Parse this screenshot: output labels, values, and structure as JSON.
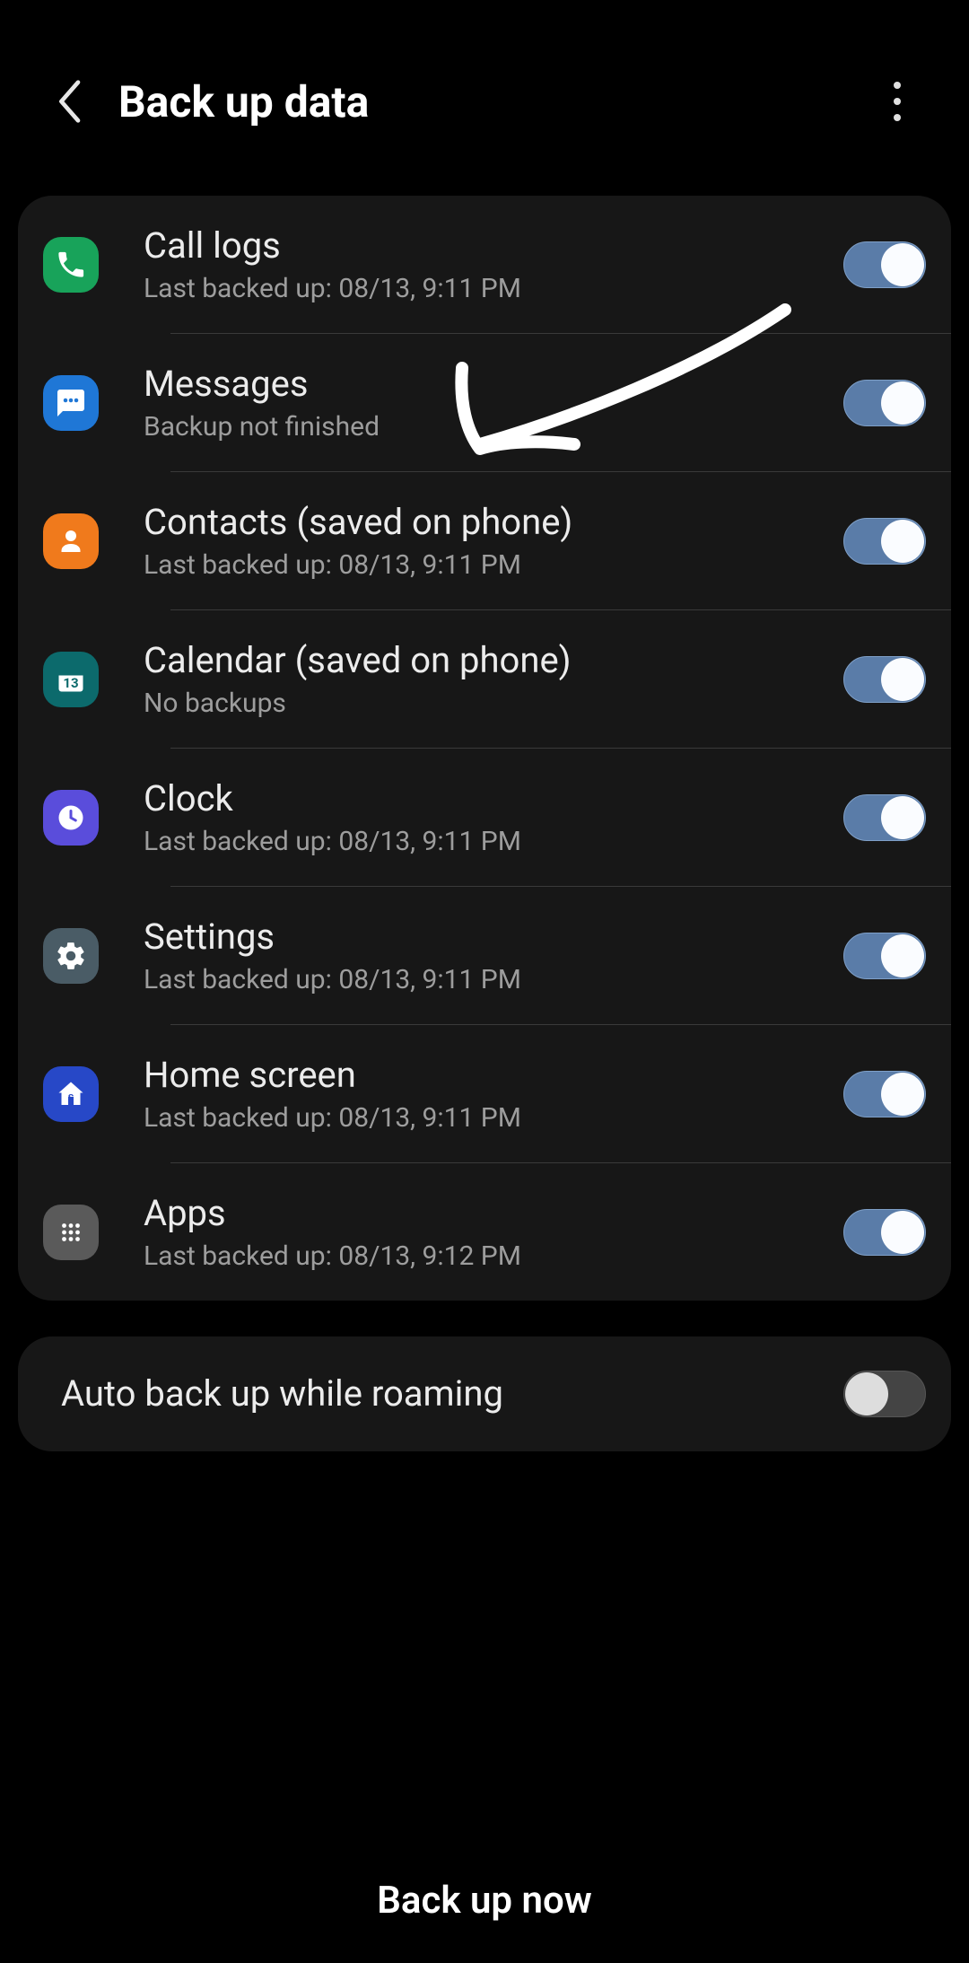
{
  "header": {
    "title": "Back up data"
  },
  "items": [
    {
      "id": "call-logs",
      "title": "Call logs",
      "sub": "Last backed up: 08/13, 9:11 PM",
      "on": true,
      "icon": "phone",
      "bg": "ic-call"
    },
    {
      "id": "messages",
      "title": "Messages",
      "sub": "Backup not finished",
      "on": true,
      "icon": "chat",
      "bg": "ic-msg"
    },
    {
      "id": "contacts",
      "title": "Contacts (saved on phone)",
      "sub": "Last backed up: 08/13, 9:11 PM",
      "on": true,
      "icon": "person",
      "bg": "ic-contacts"
    },
    {
      "id": "calendar",
      "title": "Calendar (saved on phone)",
      "sub": "No backups",
      "on": true,
      "icon": "calendar",
      "bg": "ic-cal"
    },
    {
      "id": "clock",
      "title": "Clock",
      "sub": "Last backed up: 08/13, 9:11 PM",
      "on": true,
      "icon": "clock",
      "bg": "ic-clock"
    },
    {
      "id": "settings",
      "title": "Settings",
      "sub": "Last backed up: 08/13, 9:11 PM",
      "on": true,
      "icon": "gear",
      "bg": "ic-settings"
    },
    {
      "id": "home",
      "title": "Home screen",
      "sub": "Last backed up: 08/13, 9:11 PM",
      "on": true,
      "icon": "home",
      "bg": "ic-home"
    },
    {
      "id": "apps",
      "title": "Apps",
      "sub": "Last backed up: 08/13, 9:12 PM",
      "on": true,
      "icon": "grid",
      "bg": "ic-apps"
    }
  ],
  "roaming": {
    "title": "Auto back up while roaming",
    "on": false
  },
  "bottom": {
    "label": "Back up now"
  }
}
